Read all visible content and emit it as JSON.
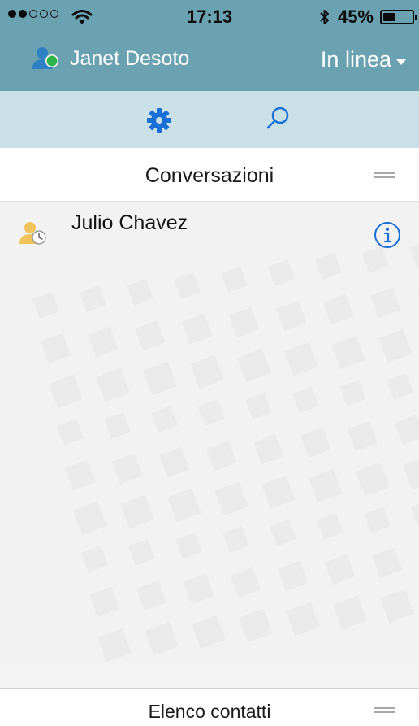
{
  "status_bar": {
    "signal_bars_filled": 2,
    "signal_bars_total": 5,
    "time": "17:13",
    "battery_text": "45%",
    "battery_level": 0.45,
    "icons": [
      "wifi-icon",
      "bluetooth-icon",
      "battery-icon"
    ]
  },
  "header": {
    "user_name": "Janet Desoto",
    "presence_label": "In linea",
    "presence_color": "#2db34a",
    "background": "#6aa2b2"
  },
  "toolbar": {
    "background": "#c9e0e6",
    "accent": "#1a6fd6",
    "icons": [
      "gear-icon",
      "search-icon"
    ]
  },
  "conversations": {
    "title": "Conversazioni",
    "items": [
      {
        "name": "Julio Chavez",
        "icon": "contact-away-icon"
      }
    ]
  },
  "bottom": {
    "title": "Elenco contatti"
  }
}
